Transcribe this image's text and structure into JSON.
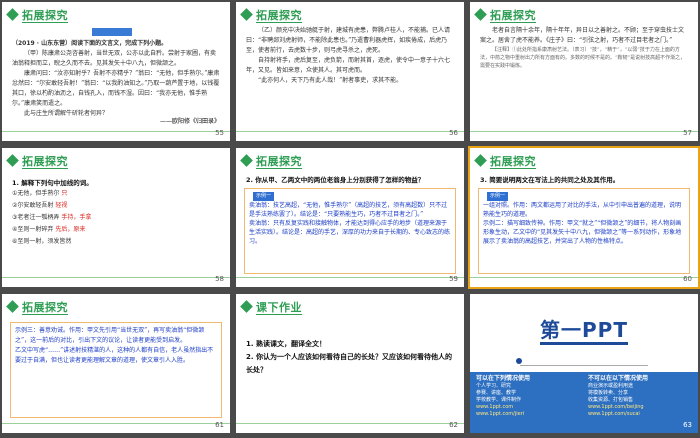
{
  "slides": [
    {
      "num": "55",
      "header": "拓展探究",
      "title": "（2019 · 山东东营）阅读下面的文言文，完成下列小题。",
      "lines": [
        "（甲）陈康肃公尧咨善射，当世无双，公亦以此自矜。尝射于家圃，有卖油翁释担而立，睨之久而不去。见其发矢十中八九，但微颔之。",
        "康肃问曰：“汝亦知射乎？吾射不亦精乎？”翁曰：“无他，但手熟尔。”康肃忿然曰：“尔安敢轻吾射！”翁曰：“以我酌油知之。”乃取一葫芦置于地，以钱覆其口，徐以杓酌油沥之，自钱孔入，而钱不湿。因曰：“我亦无他，惟手熟尔。”康肃笑而遣之。",
        "此与庄生所谓解牛斫轮者何异？"
      ],
      "source": "——欧阳修《归田录》"
    },
    {
      "num": "56",
      "header": "拓展探究",
      "lines": [
        "（乙）颜充中决始驰艇于射，建城有虎患，弊腾卢桂人，不能捕。已人请曰：“非聘郯刘虎射师，不能除此患也。”乃遣曹利器虎挥，如疾倦成，后虎乃至，使者前行，去虎数十步，则弓虎寻杀之，虎死。",
        "自持射将手，虎后复至，虎负箭，而射其首，逐虎，使令中一意子十六七年，又见。皆如来意，众使其人。其可虎而。",
        "“此亦何人，天下乃有此人哉！”射者事吏，求其不能。"
      ]
    },
    {
      "num": "57",
      "header": "拓展探究",
      "lines": [
        "老者自言隔十余年，隔十年年，异日以之善射之。不顾；至于穿虫技士文案之。居舍了虎不能养。《庄子》曰：“引弦之射，巧者不过目老者之门。”",
        "【注释】①此处所指系康肃射艺法。（表习）“技”，“精于”，“以弱”技于力在上面的方法，中箭之物中重射出力所有方面有的。多数的时候不是的。“鞍韧”是说射技高超不作渐之，需要在实践中锻炼。"
      ]
    },
    {
      "num": "58",
      "header": "拓展探究",
      "qtitle": "1. 解释下列句中加线的词。",
      "items": [
        {
          "q": "①无他，但手熟尔",
          "a": "只"
        },
        {
          "q": "②尔安敢轻吾射",
          "a": "轻视"
        },
        {
          "q": "③老者注一瓠柄弄",
          "a": "手持，手拿"
        },
        {
          "q": "④至则一射碎弃",
          "a": "先后，原来"
        },
        {
          "q": "⑤至则一射",
          "a": ""
        }
      ],
      "extra": "⑥至则一射，须发皆然"
    },
    {
      "num": "59",
      "header": "拓展探究",
      "qtitle": "2. 你从甲、乙两文中的两位老翁身上分别获得了怎样的物益？",
      "badge": "示例一",
      "lines": [
        "卖油翁：技艺高超，“无他，惟手熟尔”（高超的技艺，须有高超数）只不过是手法熟练罢了）。结论是：“只要熟能生巧，巧者不过目者之门。”",
        "卖油翁：只有反复实践和接触物体，才能达到得心应手的地步（道理来源于生活实践）。结论是：高超的手艺，深厚的功力来自于长期的、专心致志的练习。"
      ]
    },
    {
      "num": "60",
      "header": "拓展探究",
      "qtitle": "3. 简要说明两文在写法上的共同之处及其作用。",
      "badge": "示例一",
      "lines": [
        "一组对照。作用：两文都运用了对比的手法，从中引申出普遍的道理，说明熟能生巧的道理。",
        "示例二：描写细致传神。作用：甲文“就之”“但微颔之”的细节，将人物刻画形象生动，乙文中的“见其发矢十中八九，但微颔之”等一系列动作，形象地展示了卖油翁的高超技艺，并突出了人物的性格特点。"
      ]
    },
    {
      "num": "61",
      "header": "拓展探究",
      "lines": [
        "示例三：善意劝诫。作用：甲文先引用“当世无双”，再写卖油翁“但微颔之”，这一前后的对比，引出下文的议论，让读者更能受到启发。",
        "乙文中写虎“……”讲述射技精湛的人，这种的人都有自信，老人虽然指出不要过于自满，但也让读者更能理解文章的道理，使文章引人入胜。"
      ]
    },
    {
      "num": "62",
      "header": "课下作业",
      "tasks": [
        "1. 熟读课文，翻译全文！",
        "2. 你认为一个人应该如何看待自己的长处？又应该如何看待他人的长处？"
      ]
    },
    {
      "num": "63",
      "logo": "第一PPT",
      "left_title": "可以在下列情况使用",
      "left_lines": [
        "个人学习、研究",
        "参赛、讲座、教学",
        "学校教学、课件制作"
      ],
      "right_title": "不可以在以下情况使用",
      "right_lines": [
        "商业演示或盈利用途",
        "将模板转卖、分享",
        "收集资源、打包销售"
      ],
      "links": [
        "www.1ppt.com",
        "www.1ppt.com/jieri",
        "www.1ppt.com/beijing",
        "www.1ppt.com/sucai"
      ]
    }
  ],
  "colors": {
    "accent": "#2f9e54",
    "selected_outline": "#e8a317",
    "answer_red": "#d9231c",
    "answer_blue": "#1b3cc6",
    "dl_panel": "#2d6fc0"
  }
}
